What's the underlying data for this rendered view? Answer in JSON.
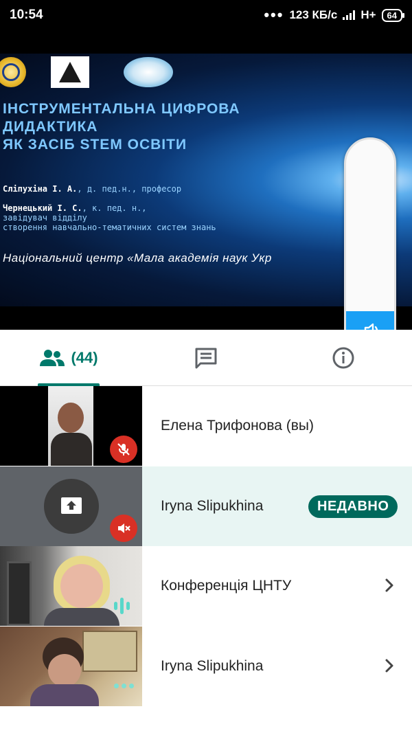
{
  "status_bar": {
    "time": "10:54",
    "network_speed": "123 КБ/с",
    "network_type": "H+",
    "battery": "64"
  },
  "slide": {
    "title_lines": [
      "ІНСТРУМЕНТАЛЬНА ЦИФРОВА",
      "ДИДАКТИКА",
      "ЯК ЗАСІБ STEM ОСВІТИ"
    ],
    "author1_name": "Сліпухіна І. А.",
    "author1_role": ", д. пед.н., професор",
    "author2_name": "Чернецький І. С.",
    "author2_role": ", к. пед. н.,",
    "author2_role_line2": "завідувач відділу",
    "author2_role_line3": "створення навчально-тематичних систем знань",
    "institution": "Національний центр «Мала академія наук Укр"
  },
  "volume": {
    "level": 0.2
  },
  "tabs": {
    "people_count": "(44)"
  },
  "participants": [
    {
      "name": "Елена Трифонова (вы)",
      "mic": "muted"
    },
    {
      "name": "Iryna Slipukhina",
      "badge": "НЕДАВНО",
      "mic": "muted"
    },
    {
      "name": "Конференція ЦНТУ",
      "mic": "speaking"
    },
    {
      "name": "Iryna Slipukhina",
      "mic": "more"
    }
  ],
  "colors": {
    "accent": "#00796b",
    "mute_red": "#d93025",
    "volume_blue": "#1aa0f5"
  }
}
